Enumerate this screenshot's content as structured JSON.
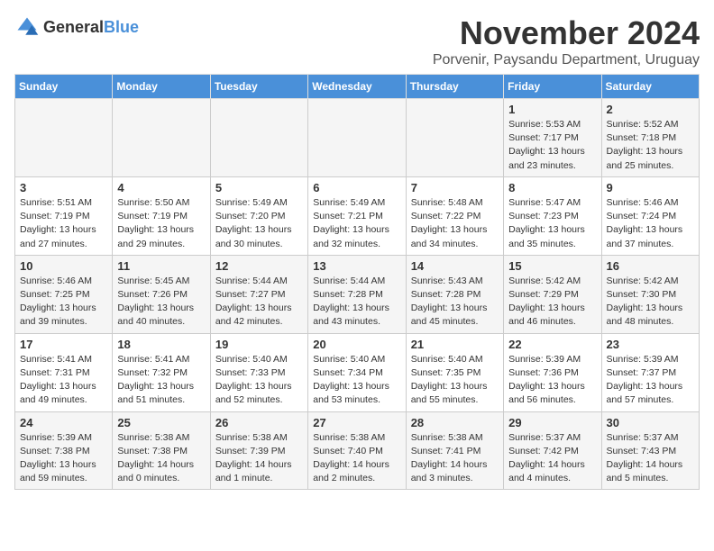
{
  "logo": {
    "general": "General",
    "blue": "Blue"
  },
  "title": "November 2024",
  "subtitle": "Porvenir, Paysandu Department, Uruguay",
  "weekdays": [
    "Sunday",
    "Monday",
    "Tuesday",
    "Wednesday",
    "Thursday",
    "Friday",
    "Saturday"
  ],
  "weeks": [
    [
      {
        "day": "",
        "info": ""
      },
      {
        "day": "",
        "info": ""
      },
      {
        "day": "",
        "info": ""
      },
      {
        "day": "",
        "info": ""
      },
      {
        "day": "",
        "info": ""
      },
      {
        "day": "1",
        "info": "Sunrise: 5:53 AM\nSunset: 7:17 PM\nDaylight: 13 hours\nand 23 minutes."
      },
      {
        "day": "2",
        "info": "Sunrise: 5:52 AM\nSunset: 7:18 PM\nDaylight: 13 hours\nand 25 minutes."
      }
    ],
    [
      {
        "day": "3",
        "info": "Sunrise: 5:51 AM\nSunset: 7:19 PM\nDaylight: 13 hours\nand 27 minutes."
      },
      {
        "day": "4",
        "info": "Sunrise: 5:50 AM\nSunset: 7:19 PM\nDaylight: 13 hours\nand 29 minutes."
      },
      {
        "day": "5",
        "info": "Sunrise: 5:49 AM\nSunset: 7:20 PM\nDaylight: 13 hours\nand 30 minutes."
      },
      {
        "day": "6",
        "info": "Sunrise: 5:49 AM\nSunset: 7:21 PM\nDaylight: 13 hours\nand 32 minutes."
      },
      {
        "day": "7",
        "info": "Sunrise: 5:48 AM\nSunset: 7:22 PM\nDaylight: 13 hours\nand 34 minutes."
      },
      {
        "day": "8",
        "info": "Sunrise: 5:47 AM\nSunset: 7:23 PM\nDaylight: 13 hours\nand 35 minutes."
      },
      {
        "day": "9",
        "info": "Sunrise: 5:46 AM\nSunset: 7:24 PM\nDaylight: 13 hours\nand 37 minutes."
      }
    ],
    [
      {
        "day": "10",
        "info": "Sunrise: 5:46 AM\nSunset: 7:25 PM\nDaylight: 13 hours\nand 39 minutes."
      },
      {
        "day": "11",
        "info": "Sunrise: 5:45 AM\nSunset: 7:26 PM\nDaylight: 13 hours\nand 40 minutes."
      },
      {
        "day": "12",
        "info": "Sunrise: 5:44 AM\nSunset: 7:27 PM\nDaylight: 13 hours\nand 42 minutes."
      },
      {
        "day": "13",
        "info": "Sunrise: 5:44 AM\nSunset: 7:28 PM\nDaylight: 13 hours\nand 43 minutes."
      },
      {
        "day": "14",
        "info": "Sunrise: 5:43 AM\nSunset: 7:28 PM\nDaylight: 13 hours\nand 45 minutes."
      },
      {
        "day": "15",
        "info": "Sunrise: 5:42 AM\nSunset: 7:29 PM\nDaylight: 13 hours\nand 46 minutes."
      },
      {
        "day": "16",
        "info": "Sunrise: 5:42 AM\nSunset: 7:30 PM\nDaylight: 13 hours\nand 48 minutes."
      }
    ],
    [
      {
        "day": "17",
        "info": "Sunrise: 5:41 AM\nSunset: 7:31 PM\nDaylight: 13 hours\nand 49 minutes."
      },
      {
        "day": "18",
        "info": "Sunrise: 5:41 AM\nSunset: 7:32 PM\nDaylight: 13 hours\nand 51 minutes."
      },
      {
        "day": "19",
        "info": "Sunrise: 5:40 AM\nSunset: 7:33 PM\nDaylight: 13 hours\nand 52 minutes."
      },
      {
        "day": "20",
        "info": "Sunrise: 5:40 AM\nSunset: 7:34 PM\nDaylight: 13 hours\nand 53 minutes."
      },
      {
        "day": "21",
        "info": "Sunrise: 5:40 AM\nSunset: 7:35 PM\nDaylight: 13 hours\nand 55 minutes."
      },
      {
        "day": "22",
        "info": "Sunrise: 5:39 AM\nSunset: 7:36 PM\nDaylight: 13 hours\nand 56 minutes."
      },
      {
        "day": "23",
        "info": "Sunrise: 5:39 AM\nSunset: 7:37 PM\nDaylight: 13 hours\nand 57 minutes."
      }
    ],
    [
      {
        "day": "24",
        "info": "Sunrise: 5:39 AM\nSunset: 7:38 PM\nDaylight: 13 hours\nand 59 minutes."
      },
      {
        "day": "25",
        "info": "Sunrise: 5:38 AM\nSunset: 7:38 PM\nDaylight: 14 hours\nand 0 minutes."
      },
      {
        "day": "26",
        "info": "Sunrise: 5:38 AM\nSunset: 7:39 PM\nDaylight: 14 hours\nand 1 minute."
      },
      {
        "day": "27",
        "info": "Sunrise: 5:38 AM\nSunset: 7:40 PM\nDaylight: 14 hours\nand 2 minutes."
      },
      {
        "day": "28",
        "info": "Sunrise: 5:38 AM\nSunset: 7:41 PM\nDaylight: 14 hours\nand 3 minutes."
      },
      {
        "day": "29",
        "info": "Sunrise: 5:37 AM\nSunset: 7:42 PM\nDaylight: 14 hours\nand 4 minutes."
      },
      {
        "day": "30",
        "info": "Sunrise: 5:37 AM\nSunset: 7:43 PM\nDaylight: 14 hours\nand 5 minutes."
      }
    ]
  ]
}
